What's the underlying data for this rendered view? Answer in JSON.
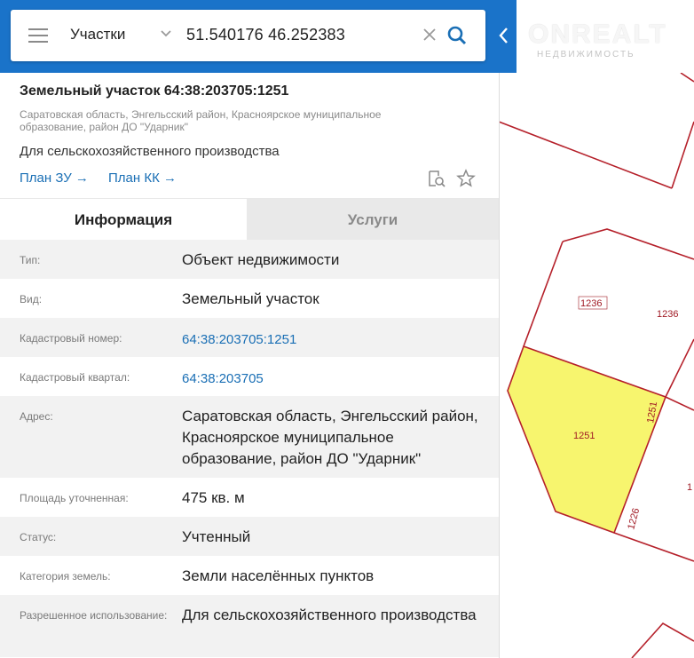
{
  "search": {
    "layer": "Участки",
    "query": "51.540176 46.252383"
  },
  "brand": {
    "name": "ONREALT",
    "tagline": "НЕДВИЖИМОСТЬ"
  },
  "object": {
    "title": "Земельный участок 64:38:203705:1251",
    "address": "Саратовская область, Энгельсский район, Красноярское муниципальное образование, район ДО \"Ударник\"",
    "purpose": "Для сельскохозяйственного производства",
    "link_plan_zu": "План ЗУ",
    "link_plan_kk": "План КК"
  },
  "tabs": {
    "info": "Информация",
    "services": "Услуги"
  },
  "info": [
    {
      "label": "Тип:",
      "value": "Объект недвижимости"
    },
    {
      "label": "Вид:",
      "value": "Земельный участок"
    },
    {
      "label": "Кадастровый номер:",
      "value": "64:38:203705:1251"
    },
    {
      "label": "Кадастровый квартал:",
      "value": "64:38:203705"
    },
    {
      "label": "Адрес:",
      "value": "Саратовская область, Энгельсский район, Красноярское муниципальное образование, район ДО \"Ударник\""
    },
    {
      "label": "Площадь уточненная:",
      "value": "475 кв. м"
    },
    {
      "label": "Статус:",
      "value": "Учтенный"
    },
    {
      "label": "Категория земель:",
      "value": "Земли населённых пунктов"
    },
    {
      "label": "Разрешенное использование:",
      "value": "Для сельскохозяйственного производства"
    }
  ],
  "map": {
    "labels": [
      "1236",
      "1236",
      "1251",
      "1251",
      "1226",
      "1"
    ],
    "highlight_color": "#f7f56e",
    "line_color": "#b5202a"
  },
  "colors": {
    "header": "#1a73c9",
    "link": "#1a6fb5"
  },
  "icons": [
    "menu-icon",
    "chevron-down-icon",
    "clear-icon",
    "search-icon",
    "collapse-arrow-icon",
    "arrow-right-icon",
    "magnify-document-icon",
    "star-icon"
  ]
}
